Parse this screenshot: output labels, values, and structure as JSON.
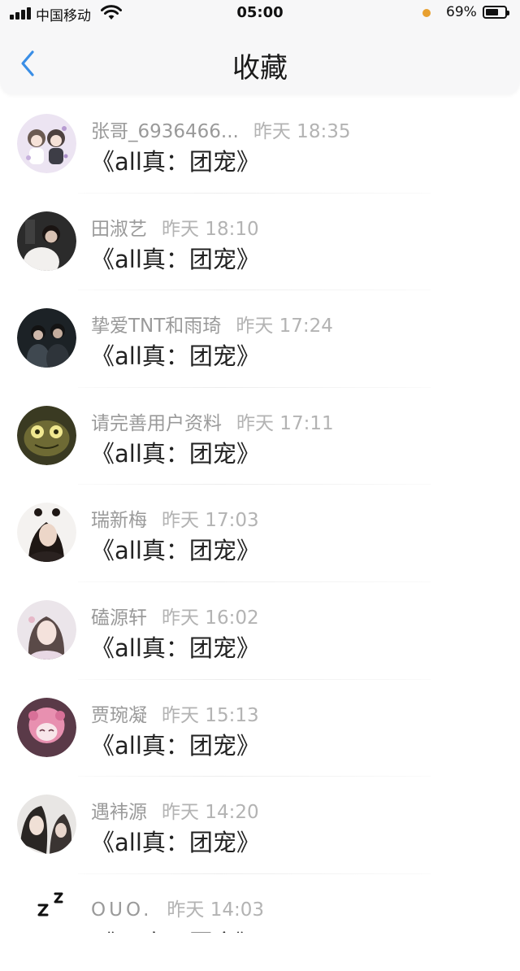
{
  "status_bar": {
    "carrier": "中国移动",
    "time": "05:00",
    "battery_percent": "69%",
    "battery_level": 0.69,
    "indicator_color": "#e8a030"
  },
  "nav": {
    "back_icon": "chevron-left-icon",
    "title": "收藏",
    "accent": "#3a8ee6"
  },
  "items": [
    {
      "name": "张哥_6936466...",
      "time": "昨天 18:35",
      "title": "《all真：团宠》"
    },
    {
      "name": "田淑艺",
      "time": "昨天 18:10",
      "title": "《all真：团宠》"
    },
    {
      "name": "挚爱TNT和雨琦",
      "time": "昨天 17:24",
      "title": "《all真：团宠》"
    },
    {
      "name": "请完善用户资料",
      "time": "昨天 17:11",
      "title": "《all真：团宠》"
    },
    {
      "name": "瑞新梅",
      "time": "昨天 17:03",
      "title": "《all真：团宠》"
    },
    {
      "name": "磕源轩",
      "time": "昨天 16:02",
      "title": "《all真：团宠》"
    },
    {
      "name": "贾琬凝",
      "time": "昨天 15:13",
      "title": "《all真：团宠》"
    },
    {
      "name": "遇袆源",
      "time": "昨天 14:20",
      "title": "《all真：团宠》"
    },
    {
      "name": "OUO.",
      "time": "昨天 14:03",
      "title": "《all真：团宠》"
    }
  ]
}
